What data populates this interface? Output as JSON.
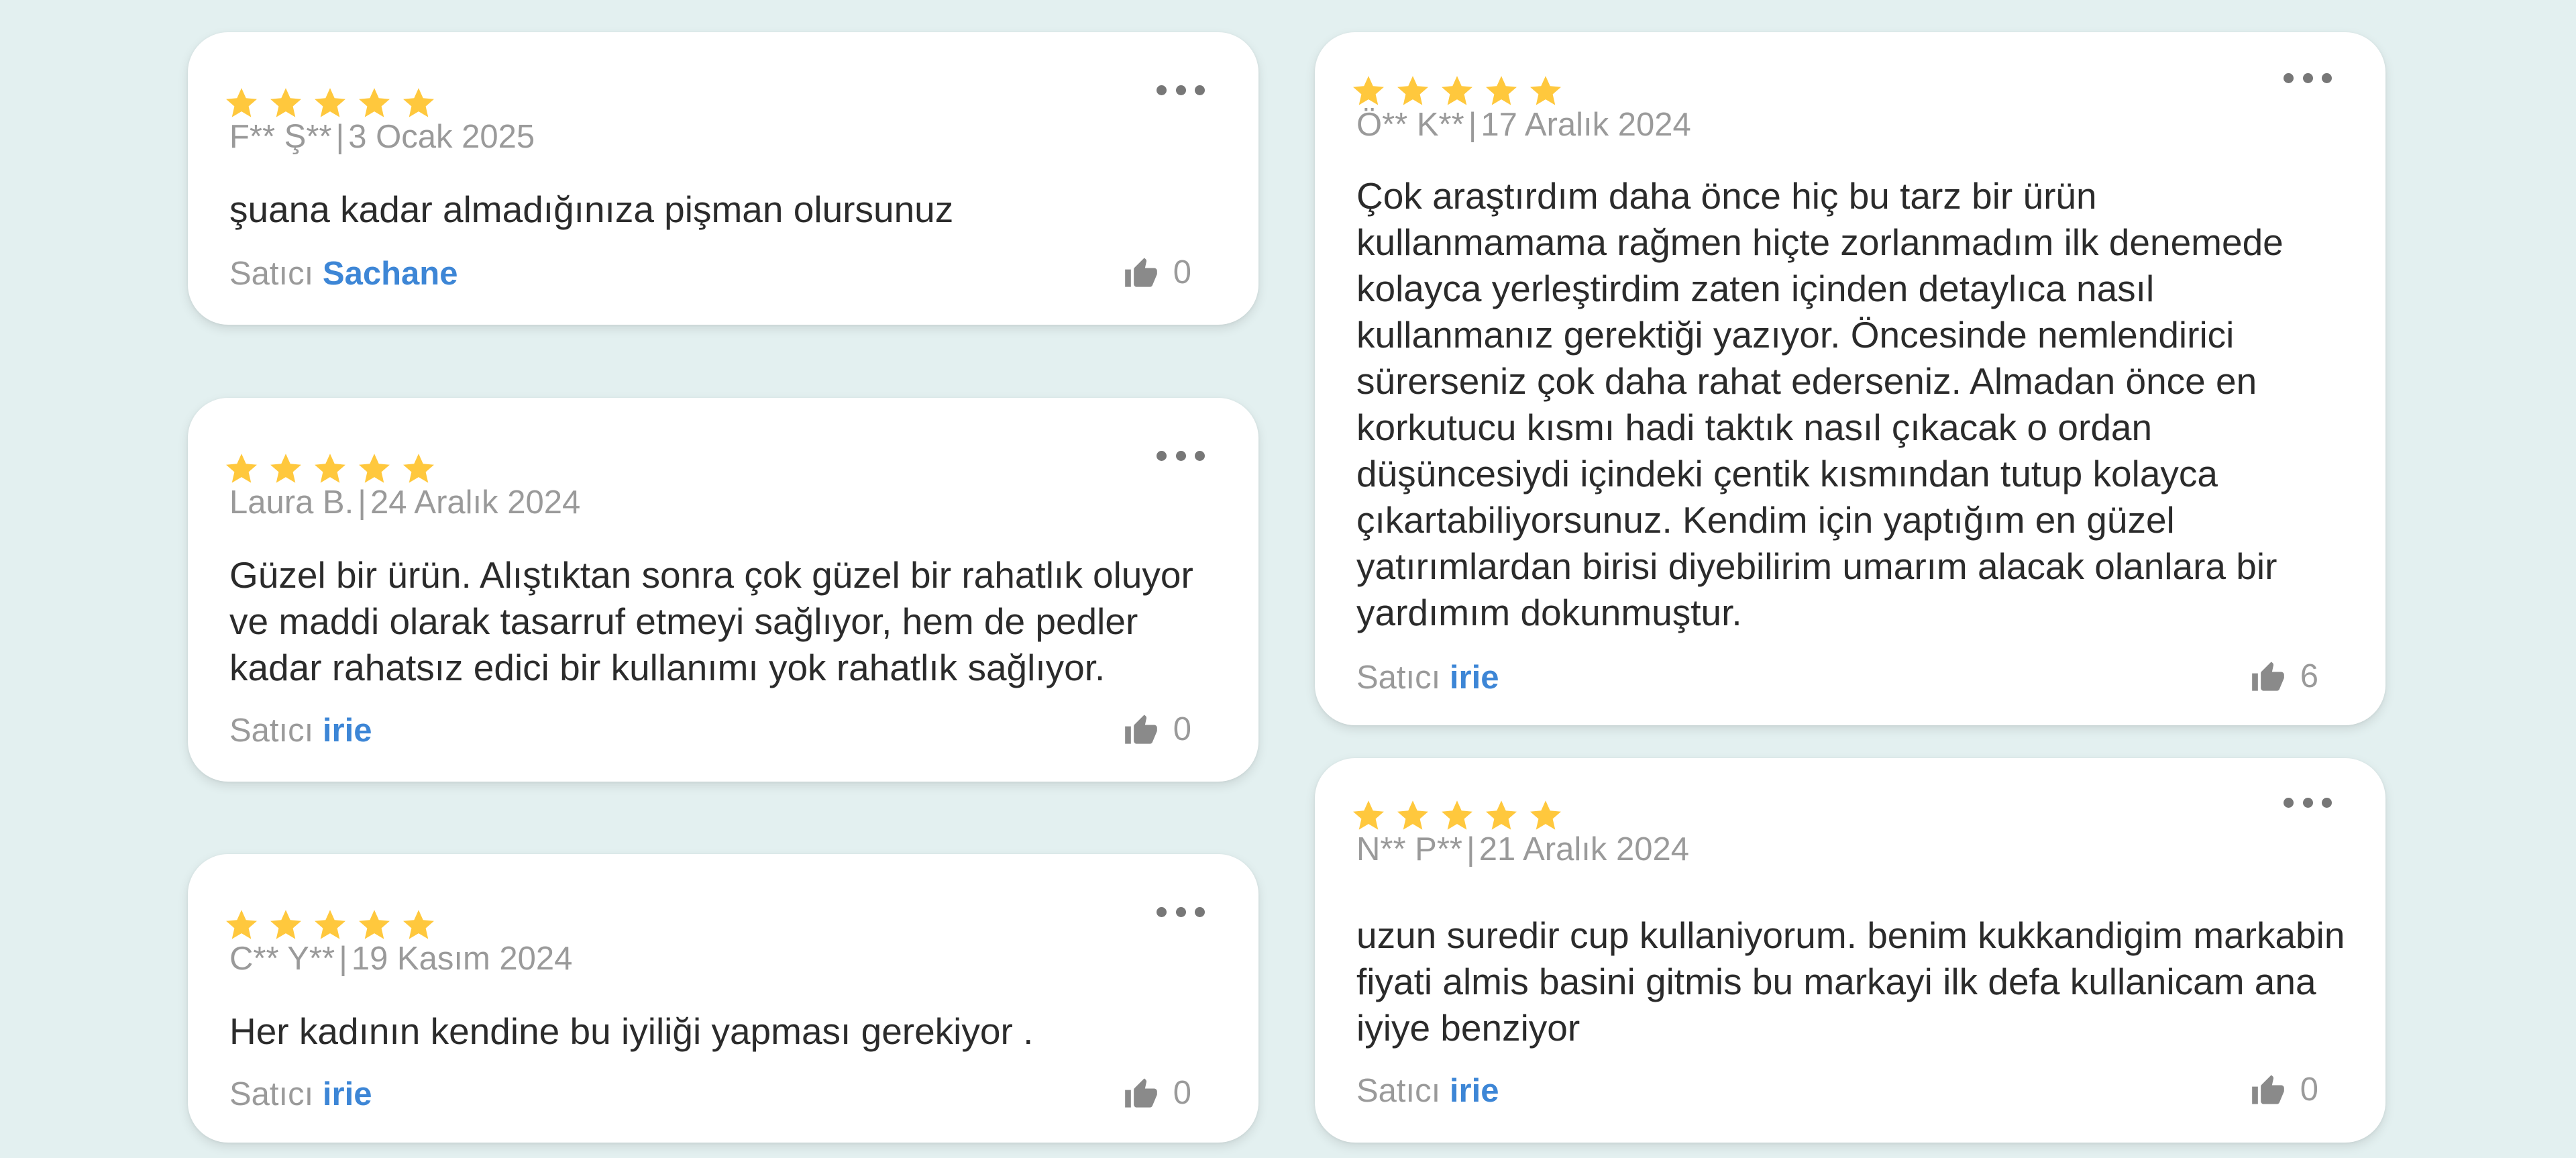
{
  "reviews": [
    {
      "rating": 5,
      "author": "F** Ş**",
      "date": "3 Ocak 2025",
      "separator": "|",
      "text": "şuana kadar almadığınıza pişman olursunuz",
      "seller_label": "Satıcı",
      "seller": "Sachane",
      "likes": "0"
    },
    {
      "rating": 5,
      "author": "Laura B.",
      "date": "24 Aralık 2024",
      "separator": "|",
      "text": "Güzel bir ürün. Alıştıktan sonra çok güzel bir rahatlık oluyor ve maddi olarak tasarruf etmeyi sağlıyor, hem de pedler kadar rahatsız edici bir kullanımı yok rahatlık sağlıyor.",
      "seller_label": "Satıcı",
      "seller": "irie",
      "likes": "0"
    },
    {
      "rating": 5,
      "author": "C** Y**",
      "date": "19 Kasım 2024",
      "separator": "|",
      "text": "Her kadının kendine bu iyiliği yapması gerekiyor .",
      "seller_label": "Satıcı",
      "seller": "irie",
      "likes": "0"
    },
    {
      "rating": 5,
      "author": "Ö** K**",
      "date": "17 Aralık 2024",
      "separator": "|",
      "text": "Çok araştırdım daha önce hiç bu tarz bir ürün kullanmamama rağmen hiçte zorlanmadım ilk denemede kolayca yerleştirdim zaten içinden detaylıca nasıl kullanmanız gerektiği yazıyor. Öncesinde nemlendirici sürerseniz çok daha rahat ederseniz. Almadan önce en korkutucu kısmı hadi taktık nasıl çıkacak o ordan düşüncesiydi içindeki çentik kısmından tutup kolayca çıkartabiliyorsunuz. Kendim için yaptığım en güzel yatırımlardan birisi diyebilirim umarım alacak olanlara bir yardımım dokunmuştur.",
      "seller_label": "Satıcı",
      "seller": "irie",
      "likes": "6"
    },
    {
      "rating": 5,
      "author": "N** P**",
      "date": "21 Aralık 2024",
      "separator": "|",
      "text": "uzun suredir cup kullaniyorum. benim kukkandigim markabin fiyati almis basini gitmis bu markayi ilk defa kullanicam ana iyiye benziyor",
      "seller_label": "Satıcı",
      "seller": "irie",
      "likes": "0"
    }
  ],
  "icons": {
    "rating": "star-icon",
    "menu": "more-options-icon",
    "like": "thumbs-up-icon"
  },
  "colors": {
    "background": "#e3f0f0",
    "star": "#ffc83d",
    "seller_link": "#3d86d6",
    "muted_text": "#9a9a9a"
  }
}
